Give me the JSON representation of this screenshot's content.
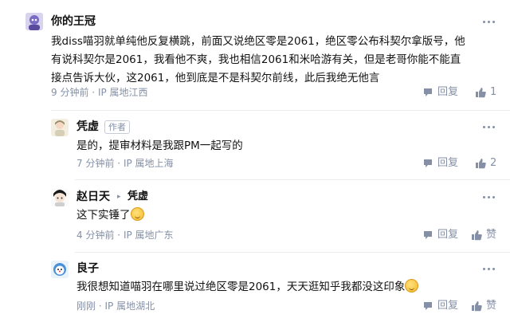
{
  "comments": [
    {
      "name": "你的王冠",
      "lines": [
        "我diss喵羽就单纯他反复横跳，前面又说绝区零是2061，绝区零公布科契尔拿版号，他",
        "有说科契尔是2061，我看他不爽，我也相信2061和米哈游有关，但是老哥你能不能直",
        "接点告诉大伙，这2061，他到底是不是科契尔前线，此后我绝无他言"
      ],
      "time": "9 分钟前",
      "ip": "IP 属地江西",
      "reply_label": "回复",
      "like_count": "1"
    },
    {
      "name": "凭虚",
      "badge": "作者",
      "lines": [
        "是的，提审材料是我跟PM一起写的"
      ],
      "time": "7 分钟前",
      "ip": "IP 属地上海",
      "reply_label": "回复",
      "like_count": "2"
    },
    {
      "name": "赵日天",
      "reply_to": "凭虚",
      "lines": [
        "这下实锤了"
      ],
      "time": "4 分钟前",
      "ip": "IP 属地广东",
      "reply_label": "回复",
      "like_label": "赞"
    },
    {
      "name": "良子",
      "lines": [
        "我很想知道喵羽在哪里说过绝区零是2061，天天逛知乎我都没这印象"
      ],
      "time": "刚刚",
      "ip": "IP 属地湖北",
      "reply_label": "回复",
      "like_label": "赞"
    }
  ],
  "separator": "·",
  "reply_arrow": "▸"
}
